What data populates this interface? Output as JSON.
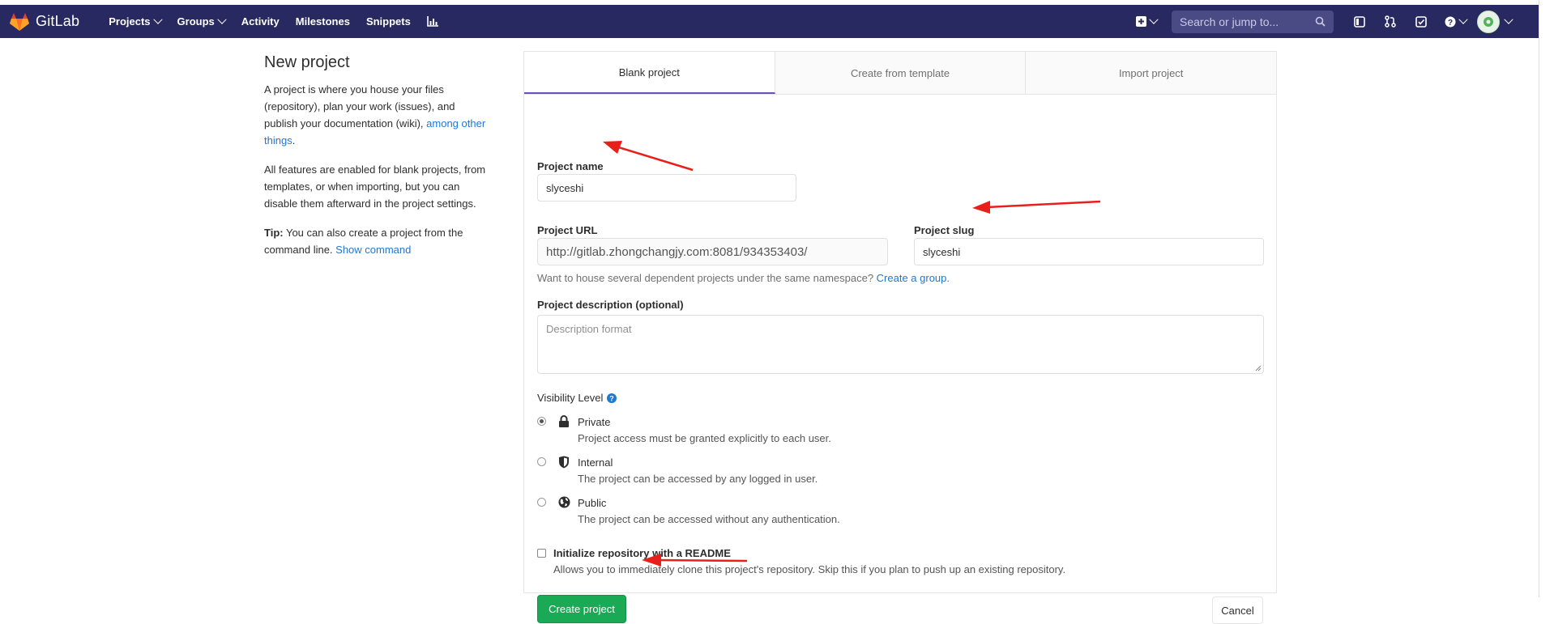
{
  "navbar": {
    "brand": "GitLab",
    "links": [
      {
        "label": "Projects",
        "has_caret": true
      },
      {
        "label": "Groups",
        "has_caret": true
      },
      {
        "label": "Activity",
        "has_caret": false
      },
      {
        "label": "Milestones",
        "has_caret": false
      },
      {
        "label": "Snippets",
        "has_caret": false
      }
    ],
    "search_placeholder": "Search or jump to...",
    "bg_color": "#292961",
    "icons": [
      "chart-icon",
      "plus-icon",
      "search-icon",
      "sidebar-icon",
      "merge-request-icon",
      "todo-icon",
      "help-icon",
      "avatar-icon"
    ]
  },
  "intro": {
    "title": "New project",
    "para1_text": "A project is where you house your files (repository), plan your work (issues), and publish your documentation (wiki), ",
    "para1_link": "among other things",
    "para1_end": ".",
    "para2": "All features are enabled for blank projects, from templates, or when importing, but you can disable them afterward in the project settings.",
    "tip_label": "Tip:",
    "tip_text": " You can also create a project from the command line. ",
    "tip_link": "Show command"
  },
  "tabs": [
    {
      "label": "Blank project",
      "active": true
    },
    {
      "label": "Create from template",
      "active": false
    },
    {
      "label": "Import project",
      "active": false
    }
  ],
  "form": {
    "name_label": "Project name",
    "name_value": "slyceshi",
    "url_label": "Project URL",
    "url_value": "http://gitlab.zhongchangjy.com:8081/934353403/",
    "slug_label": "Project slug",
    "slug_value": "slyceshi",
    "group_help": "Want to house several dependent projects under the same namespace? ",
    "group_link": "Create a group.",
    "desc_label": "Project description (optional)",
    "desc_placeholder": "Description format",
    "visibility_label": "Visibility Level",
    "visibility_options": [
      {
        "title": "Private",
        "desc": "Project access must be granted explicitly to each user.",
        "icon": "lock-icon",
        "selected": true
      },
      {
        "title": "Internal",
        "desc": "The project can be accessed by any logged in user.",
        "icon": "shield-icon",
        "selected": false
      },
      {
        "title": "Public",
        "desc": "The project can be accessed without any authentication.",
        "icon": "globe-icon",
        "selected": false
      }
    ],
    "readme_label": "Initialize repository with a README",
    "readme_desc": "Allows you to immediately clone this project's repository. Skip this if you plan to push up an existing repository.",
    "readme_checked": false,
    "create_label": "Create project",
    "cancel_label": "Cancel"
  },
  "colors": {
    "accent_tab": "#6b4fbb",
    "create_button": "#1aaa55",
    "link": "#1f78d1",
    "annotation_arrow": "#e8201a"
  }
}
